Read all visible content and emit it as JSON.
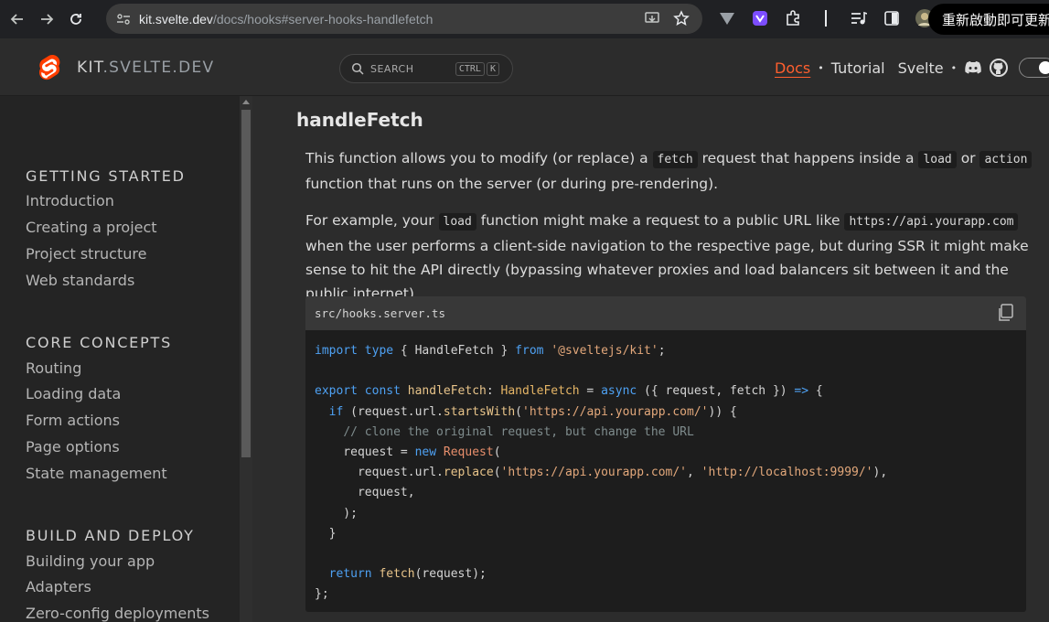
{
  "browser": {
    "url_host": "kit.svelte.dev",
    "url_path": "/docs/hooks#server-hooks-handlefetch",
    "restart_label": "重新啟動即可更新"
  },
  "site": {
    "brand_kit": "KIT",
    "brand_rest": ".SVELTE.DEV",
    "search_placeholder": "SEARCH",
    "search_keys": [
      "CTRL",
      "K"
    ],
    "nav": {
      "docs": "Docs",
      "tutorial": "Tutorial",
      "svelte": "Svelte",
      "dot": "•"
    }
  },
  "sidebar": {
    "sections": [
      {
        "title": "GETTING STARTED",
        "items": [
          "Introduction",
          "Creating a project",
          "Project structure",
          "Web standards"
        ]
      },
      {
        "title": "CORE CONCEPTS",
        "items": [
          "Routing",
          "Loading data",
          "Form actions",
          "Page options",
          "State management"
        ]
      },
      {
        "title": "BUILD AND DEPLOY",
        "items": [
          "Building your app",
          "Adapters",
          "Zero-config deployments"
        ]
      }
    ]
  },
  "content": {
    "heading": "handleFetch",
    "p1": {
      "t1": "This function allows you to modify (or replace) a ",
      "c1": "fetch",
      "t2": " request that happens inside a ",
      "c2": "load",
      "t3": " or ",
      "c3": "action",
      "t4": " function that runs on the server (or during pre-rendering)."
    },
    "p2": {
      "t1": "For example, your ",
      "c1": "load",
      "t2": " function might make a request to a public URL like ",
      "c2": "https://api.yourapp.com",
      "t3": " when the user performs a client-side navigation to the respective page, but during SSR it might make sense to hit the API directly (bypassing whatever proxies and load balancers sit between it and the public internet)."
    },
    "code_filename": "src/hooks.server.ts",
    "code_lines": [
      "import type { HandleFetch } from '@sveltejs/kit';",
      "",
      "export const handleFetch: HandleFetch = async ({ request, fetch }) => {",
      "  if (request.url.startsWith('https://api.yourapp.com/')) {",
      "    // clone the original request, but change the URL",
      "    request = new Request(",
      "      request.url.replace('https://api.yourapp.com/', 'http://localhost:9999/'),",
      "      request,",
      "    );",
      "  }",
      "",
      "  return fetch(request);",
      "};"
    ]
  }
}
